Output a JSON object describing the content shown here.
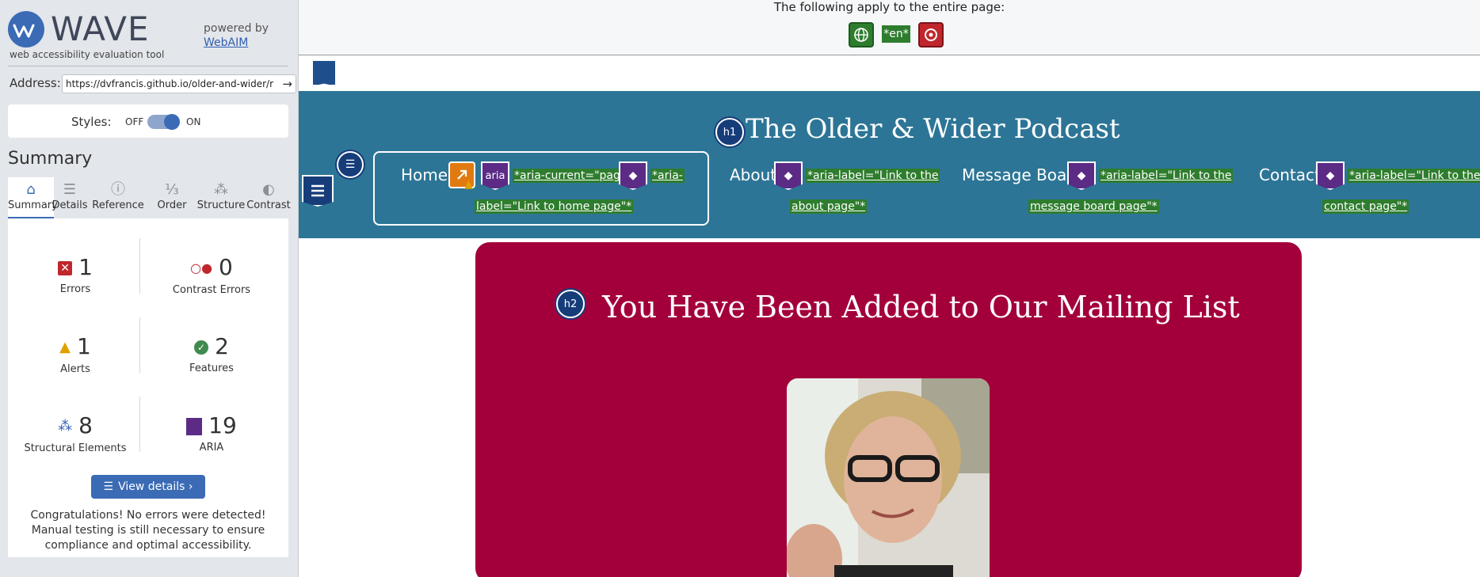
{
  "sidebar": {
    "brand_name": "WAVE",
    "brand_tagline": "web accessibility evaluation tool",
    "powered_by": "powered by",
    "webaim_link": "WebAIM",
    "address_label": "Address:",
    "address_value": "https://dvfrancis.github.io/older-and-wider/r",
    "styles_label": "Styles:",
    "styles_off": "OFF",
    "styles_on": "ON",
    "styles_enabled": true,
    "summary_title": "Summary",
    "tabs": [
      {
        "label": "Summary",
        "icon": "home-icon",
        "glyph": "⌂"
      },
      {
        "label": "Details",
        "icon": "list-icon",
        "glyph": "☰"
      },
      {
        "label": "Reference",
        "icon": "info-icon",
        "glyph": "ⓘ"
      },
      {
        "label": "Order",
        "icon": "order-icon",
        "glyph": "⅓"
      },
      {
        "label": "Structure",
        "icon": "structure-icon",
        "glyph": "⁂"
      },
      {
        "label": "Contrast",
        "icon": "contrast-icon",
        "glyph": "◐"
      }
    ],
    "stats": {
      "errors": {
        "count": "1",
        "label": "Errors",
        "color": "#c0272d"
      },
      "contrast_errors": {
        "count": "0",
        "label": "Contrast Errors",
        "color": "#c0272d"
      },
      "alerts": {
        "count": "1",
        "label": "Alerts",
        "color": "#e0a100"
      },
      "features": {
        "count": "2",
        "label": "Features",
        "color": "#3f8a4f"
      },
      "structural": {
        "count": "8",
        "label": "Structural Elements",
        "color": "#2f5fb0"
      },
      "aria": {
        "count": "19",
        "label": "ARIA",
        "color": "#5b2b86"
      }
    },
    "view_details": "View details ›",
    "congrats": "Congratulations! No errors were detected! Manual testing is still necessary to ensure compliance and optimal accessibility."
  },
  "doc_bar": {
    "text": "The following apply to the entire page:",
    "lang_tag": "*en*"
  },
  "site": {
    "h1_badge": "h1",
    "title": "The Older & Wider Podcast",
    "nav": {
      "home": "Home",
      "about": "About",
      "message_board": "Message Board",
      "contact": "Contact",
      "aria_badge": "aria",
      "home_note_1": "*aria-current=\"page\"*",
      "home_note_2": "*aria-",
      "home_note_3": "label=\"Link to home page\"*",
      "about_note_1": "*aria-label=\"Link to the",
      "about_note_2": "about page\"*",
      "board_note_1": "*aria-label=\"Link to the",
      "board_note_2": "message board page\"*",
      "contact_note_1": "*aria-label=\"Link to the",
      "contact_note_2": "contact page\"*"
    },
    "h2_badge": "h2",
    "hero_title": "You Have Been Added to Our Mailing List"
  },
  "colors": {
    "header_bg": "#2d7596",
    "hero_bg": "#a3003b",
    "wave_blue": "#3b6bb5"
  }
}
